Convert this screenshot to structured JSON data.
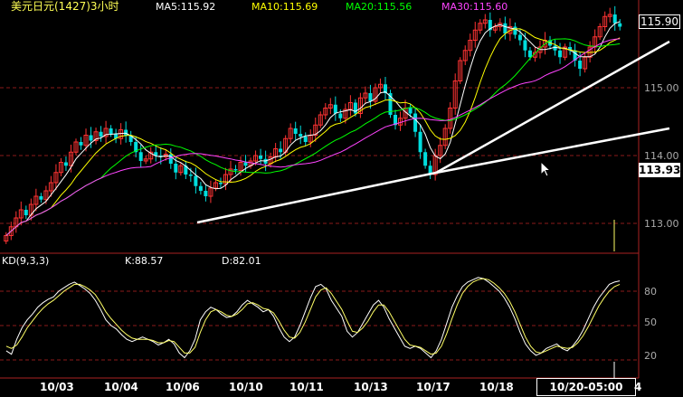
{
  "header": {
    "title": "美元日元(1427)3小时",
    "ma5": "MA5:115.92",
    "ma10": "MA10:115.69",
    "ma20": "MA20:115.56",
    "ma30": "MA30:115.60"
  },
  "price_labels": {
    "last_price": "115.90",
    "cursor_price": "113.93",
    "ticks": [
      "115.00",
      "114.00",
      "113.00"
    ]
  },
  "kd_panel": {
    "title": "KD(9,3,3)",
    "k": "K:88.57",
    "d": "D:82.01",
    "ticks": [
      "80",
      "50",
      "20"
    ]
  },
  "x_axis": {
    "ticks": [
      "10/03",
      "10/04",
      "10/06",
      "10/10",
      "10/11",
      "10/13",
      "10/17",
      "10/18"
    ],
    "cursor_time": "10/20-05:00",
    "partial_tick": "4"
  },
  "colors": {
    "bullish": "#ff3333",
    "bearish": "#00dddd",
    "ma5": "#ffffff",
    "ma10": "#ffff00",
    "ma20": "#00ff00",
    "ma30": "#ff44ff",
    "k_line": "#ffffff",
    "d_line": "#ffff66",
    "grid": "#8b1a1a",
    "trendline": "#ffffff"
  },
  "chart_data": [
    {
      "type": "candlestick",
      "title": "美元日元(1427)3小时",
      "ylim": [
        112.8,
        116.3
      ],
      "close": [
        112.82,
        112.95,
        113.08,
        113.2,
        113.12,
        113.28,
        113.4,
        113.35,
        113.48,
        113.6,
        113.75,
        113.9,
        113.85,
        114.05,
        114.2,
        114.15,
        114.3,
        114.22,
        114.35,
        114.28,
        114.4,
        114.32,
        114.25,
        114.38,
        114.3,
        114.2,
        114.05,
        113.92,
        113.95,
        114.05,
        114.0,
        113.98,
        114.02,
        113.88,
        113.75,
        113.85,
        113.72,
        113.7,
        113.55,
        113.48,
        113.4,
        113.52,
        113.6,
        113.58,
        113.72,
        113.8,
        113.78,
        113.9,
        113.85,
        113.92,
        114.0,
        113.95,
        113.88,
        113.98,
        114.1,
        114.05,
        114.25,
        114.4,
        114.32,
        114.28,
        114.2,
        114.3,
        114.45,
        114.6,
        114.7,
        114.75,
        114.62,
        114.55,
        114.68,
        114.78,
        114.62,
        114.85,
        114.92,
        114.8,
        115.0,
        115.05,
        114.92,
        114.6,
        114.45,
        114.55,
        114.7,
        114.62,
        114.35,
        114.05,
        113.85,
        113.72,
        114.0,
        114.15,
        114.4,
        114.7,
        115.1,
        115.4,
        115.55,
        115.7,
        115.85,
        115.95,
        116.0,
        115.85,
        115.9,
        115.95,
        115.8,
        115.9,
        115.78,
        115.7,
        115.55,
        115.45,
        115.52,
        115.6,
        115.7,
        115.62,
        115.55,
        115.45,
        115.6,
        115.55,
        115.4,
        115.28,
        115.45,
        115.6,
        115.75,
        115.9,
        116.05,
        116.08,
        115.95,
        115.9
      ]
    },
    {
      "type": "line",
      "title": "KD(9,3,3)",
      "ylim": [
        0,
        100
      ],
      "series": [
        {
          "name": "K",
          "values": [
            28,
            25,
            38,
            48,
            55,
            60,
            66,
            70,
            73,
            75,
            80,
            83,
            86,
            88,
            85,
            82,
            78,
            72,
            64,
            55,
            50,
            47,
            42,
            38,
            36,
            38,
            40,
            38,
            36,
            33,
            35,
            38,
            34,
            26,
            22,
            28,
            38,
            55,
            62,
            66,
            64,
            60,
            57,
            58,
            62,
            68,
            72,
            69,
            66,
            62,
            64,
            58,
            48,
            40,
            36,
            40,
            50,
            62,
            74,
            84,
            86,
            82,
            72,
            65,
            58,
            45,
            40,
            44,
            52,
            60,
            68,
            72,
            66,
            56,
            48,
            40,
            32,
            30,
            32,
            30,
            26,
            22,
            28,
            38,
            52,
            66,
            76,
            84,
            88,
            90,
            92,
            91,
            88,
            84,
            80,
            74,
            66,
            56,
            44,
            34,
            28,
            24,
            26,
            30,
            32,
            34,
            30,
            28,
            32,
            38,
            46,
            56,
            66,
            74,
            80,
            86,
            88,
            89
          ]
        },
        {
          "name": "D",
          "values": [
            32,
            30,
            33,
            40,
            48,
            54,
            60,
            65,
            69,
            72,
            76,
            80,
            83,
            86,
            86,
            84,
            81,
            77,
            70,
            62,
            56,
            51,
            46,
            42,
            39,
            38,
            38,
            38,
            37,
            35,
            35,
            37,
            36,
            31,
            26,
            26,
            31,
            44,
            55,
            62,
            64,
            62,
            59,
            58,
            60,
            64,
            69,
            70,
            68,
            65,
            64,
            61,
            54,
            46,
            40,
            39,
            44,
            53,
            64,
            75,
            81,
            83,
            78,
            71,
            64,
            54,
            45,
            44,
            48,
            54,
            62,
            68,
            68,
            62,
            54,
            46,
            38,
            33,
            32,
            31,
            28,
            25,
            26,
            32,
            43,
            56,
            68,
            78,
            84,
            88,
            90,
            91,
            90,
            87,
            83,
            78,
            71,
            62,
            51,
            40,
            32,
            27,
            26,
            28,
            30,
            32,
            31,
            30,
            31,
            35,
            41,
            49,
            58,
            67,
            74,
            80,
            84,
            86
          ]
        }
      ]
    }
  ]
}
